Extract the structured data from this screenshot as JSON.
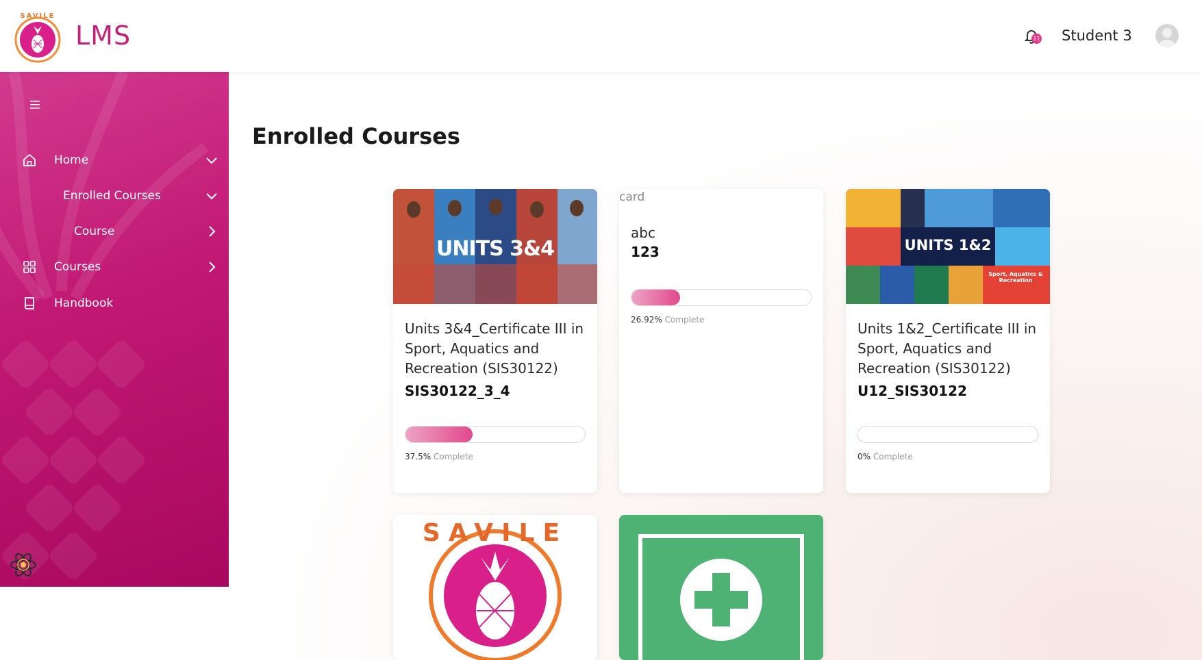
{
  "app": {
    "title": "LMS",
    "logo_text": "SAVILE",
    "brand_color": "#c2237a"
  },
  "header": {
    "notification_count": "11",
    "user_name": "Student 3"
  },
  "sidebar": {
    "menu_icon": "hamburger-icon",
    "items": [
      {
        "label": "Home",
        "icon": "home-icon",
        "chevron": "chevron-down"
      },
      {
        "label": "Enrolled Courses",
        "icon": "",
        "chevron": "chevron-down"
      },
      {
        "label": "Course",
        "icon": "",
        "chevron": "chevron-right"
      },
      {
        "label": "Courses",
        "icon": "grid-icon",
        "chevron": "chevron-right"
      },
      {
        "label": "Handbook",
        "icon": "book-icon",
        "chevron": ""
      }
    ]
  },
  "main": {
    "page_title": "Enrolled Courses",
    "courses": [
      {
        "image_text": "UNITS 3&4",
        "title": "Units 3&4_Certificate III in Sport, Aquatics and Recreation (SIS30122)",
        "code": "SIS30122_3_4",
        "progress": 37.5,
        "progress_value": "37.5%",
        "progress_suffix": "Complete"
      },
      {
        "image_alt": "card",
        "title": "abc",
        "code": "123",
        "progress": 26.92,
        "progress_value": "26.92%",
        "progress_suffix": "Complete"
      },
      {
        "image_text": "UNITS 1&2",
        "image_subtext": "Sport, Aquatics & Recreation",
        "title": "Units 1&2_Certificate III in Sport, Aquatics and Recreation (SIS30122)",
        "code": "U12_SIS30122",
        "progress": 0,
        "progress_value": "0%",
        "progress_suffix": "Complete"
      },
      {
        "image_text": "SAVILE",
        "image": "savile-pineapple-logo"
      },
      {
        "image": "first-aid-icon"
      }
    ]
  }
}
